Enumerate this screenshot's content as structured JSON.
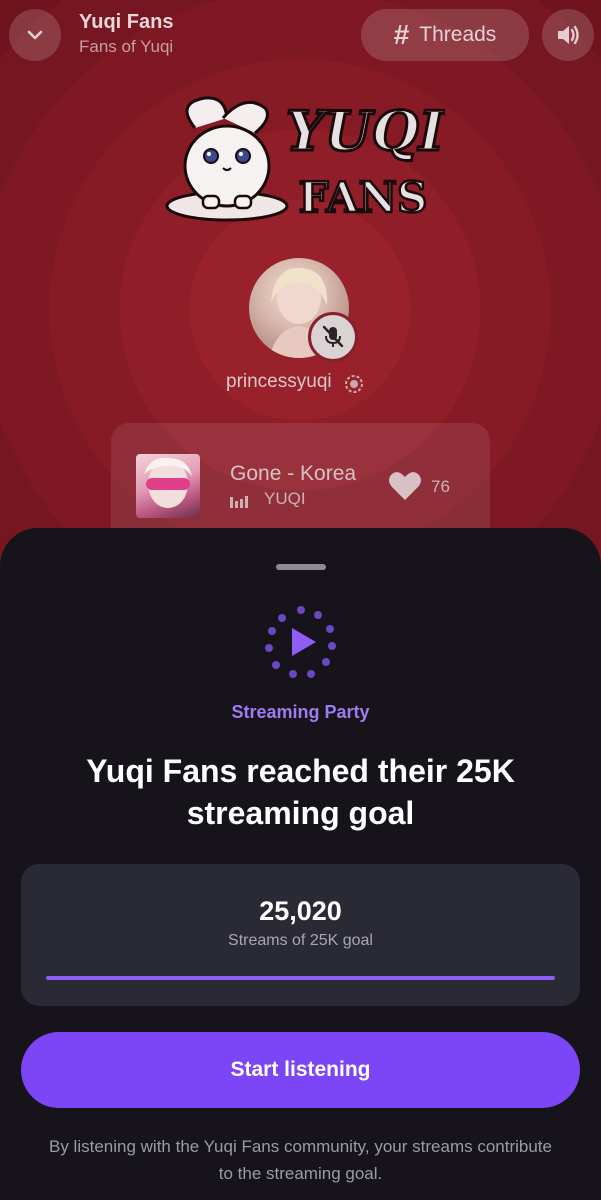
{
  "header": {
    "title": "Yuqi Fans",
    "subtitle": "Fans of Yuqi",
    "threads_label": "Threads",
    "collapse_icon": "chevron-down-icon",
    "sound_icon": "speaker-icon"
  },
  "logo": {
    "line1": "YUQI",
    "line2": "FANS"
  },
  "host": {
    "username": "princessyuqi",
    "mic_icon": "mic-muted-icon"
  },
  "now_playing": {
    "title": "Gone - Korea",
    "artist": "YUQI",
    "likes": "76"
  },
  "sheet": {
    "label": "Streaming Party",
    "headline": "Yuqi Fans reached their 25K streaming goal",
    "goal": {
      "count": "25,020",
      "caption": "Streams of 25K goal",
      "progress_fraction": 1.0
    },
    "cta_label": "Start listening",
    "footnote": "By listening with the Yuqi Fans community, your streams contribute to the streaming goal."
  },
  "colors": {
    "accent": "#7c45f6",
    "accent_text": "#9d7bf0",
    "background_red": "#8f1e29",
    "sheet_bg": "#16141a"
  }
}
